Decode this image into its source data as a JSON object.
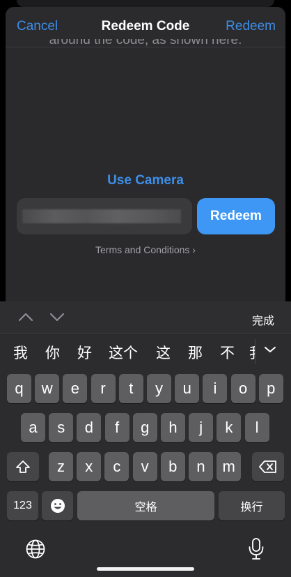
{
  "nav": {
    "cancel": "Cancel",
    "title": "Redeem Code",
    "redeem": "Redeem"
  },
  "body": {
    "cutoff_text": "around the code, as shown here.",
    "use_camera": "Use Camera",
    "redeem_button": "Redeem",
    "terms": "Terms and Conditions ›"
  },
  "keyboard": {
    "toolbar": {
      "done": "完成",
      "up_icon": "chevron-up-icon",
      "down_icon": "chevron-down-icon"
    },
    "candidates": [
      "我",
      "你",
      "好",
      "这个",
      "这",
      "那",
      "不",
      "我"
    ],
    "candidates_expand_icon": "chevron-down-icon",
    "row1": [
      "q",
      "w",
      "e",
      "r",
      "t",
      "y",
      "u",
      "i",
      "o",
      "p"
    ],
    "row2": [
      "a",
      "s",
      "d",
      "f",
      "g",
      "h",
      "j",
      "k",
      "l"
    ],
    "row3": [
      "z",
      "x",
      "c",
      "v",
      "b",
      "n",
      "m"
    ],
    "shift_icon": "shift-icon",
    "delete_icon": "delete-icon",
    "numbers": "123",
    "emoji_icon": "emoji-icon",
    "space": "空格",
    "return": "换行",
    "globe_icon": "globe-icon",
    "mic_icon": "microphone-icon"
  },
  "colors": {
    "accent": "#3d8ee8",
    "button": "#3e97f5",
    "sheet": "#2a2a2c",
    "key": "#5e5e60",
    "key_dark": "#454547"
  }
}
